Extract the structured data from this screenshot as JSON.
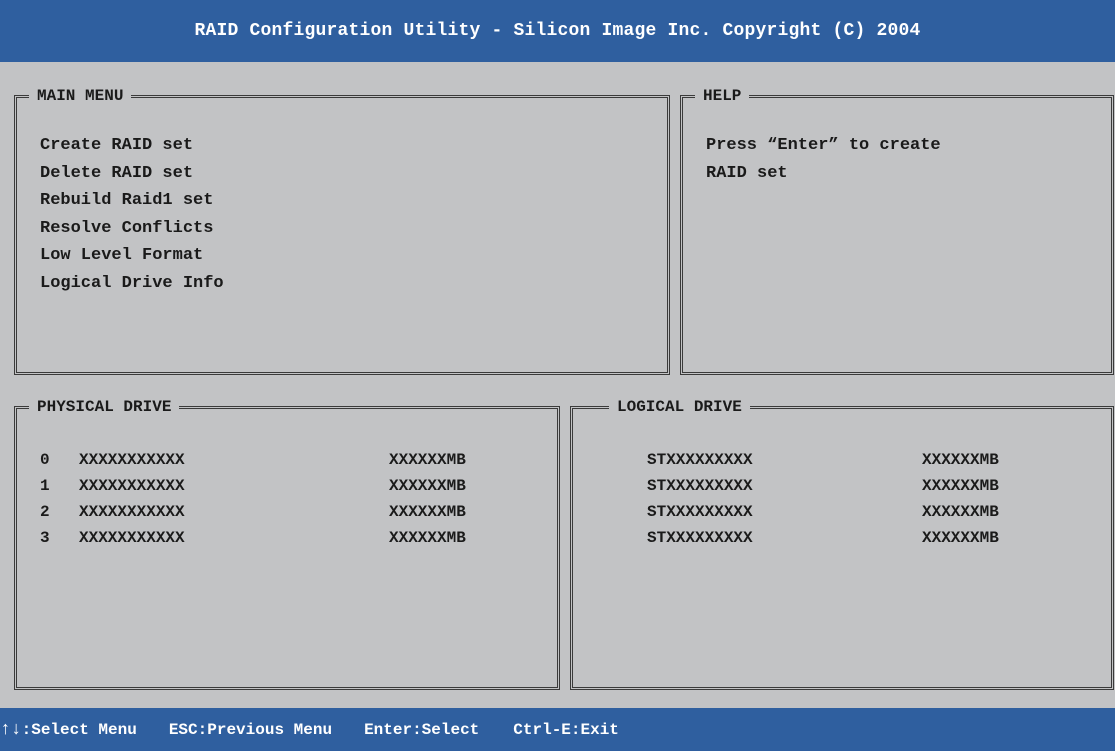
{
  "title": "RAID Configuration Utility - Silicon Image Inc. Copyright (C) 2004",
  "main_menu": {
    "heading": "MAIN MENU",
    "items": [
      "Create RAID set",
      "Delete RAID set",
      "Rebuild Raid1 set",
      "Resolve Conflicts",
      "Low Level Format",
      "Logical Drive Info"
    ]
  },
  "help": {
    "heading": "HELP",
    "lines": [
      "Press “Enter” to create",
      "RAID set"
    ]
  },
  "physical_drive": {
    "heading": "PHYSICAL DRIVE",
    "rows": [
      {
        "index": "0",
        "model": "XXXXXXXXXXX",
        "size": "XXXXXXMB"
      },
      {
        "index": "1",
        "model": "XXXXXXXXXXX",
        "size": "XXXXXXMB"
      },
      {
        "index": "2",
        "model": "XXXXXXXXXXX",
        "size": "XXXXXXMB"
      },
      {
        "index": "3",
        "model": "XXXXXXXXXXX",
        "size": "XXXXXXMB"
      }
    ]
  },
  "logical_drive": {
    "heading": "LOGICAL DRIVE",
    "rows": [
      {
        "name": "STXXXXXXXXX",
        "size": "XXXXXXMB"
      },
      {
        "name": "STXXXXXXXXX",
        "size": "XXXXXXMB"
      },
      {
        "name": "STXXXXXXXXX",
        "size": "XXXXXXMB"
      },
      {
        "name": "STXXXXXXXXX",
        "size": "XXXXXXMB"
      }
    ]
  },
  "status_bar": {
    "arrows": "↑↓",
    "select_menu": ":Select Menu",
    "previous_menu": "ESC:Previous Menu",
    "select": "Enter:Select",
    "exit": "Ctrl-E:Exit"
  },
  "colors": {
    "bar": "#2f5f9f",
    "background": "#c2c3c5"
  }
}
